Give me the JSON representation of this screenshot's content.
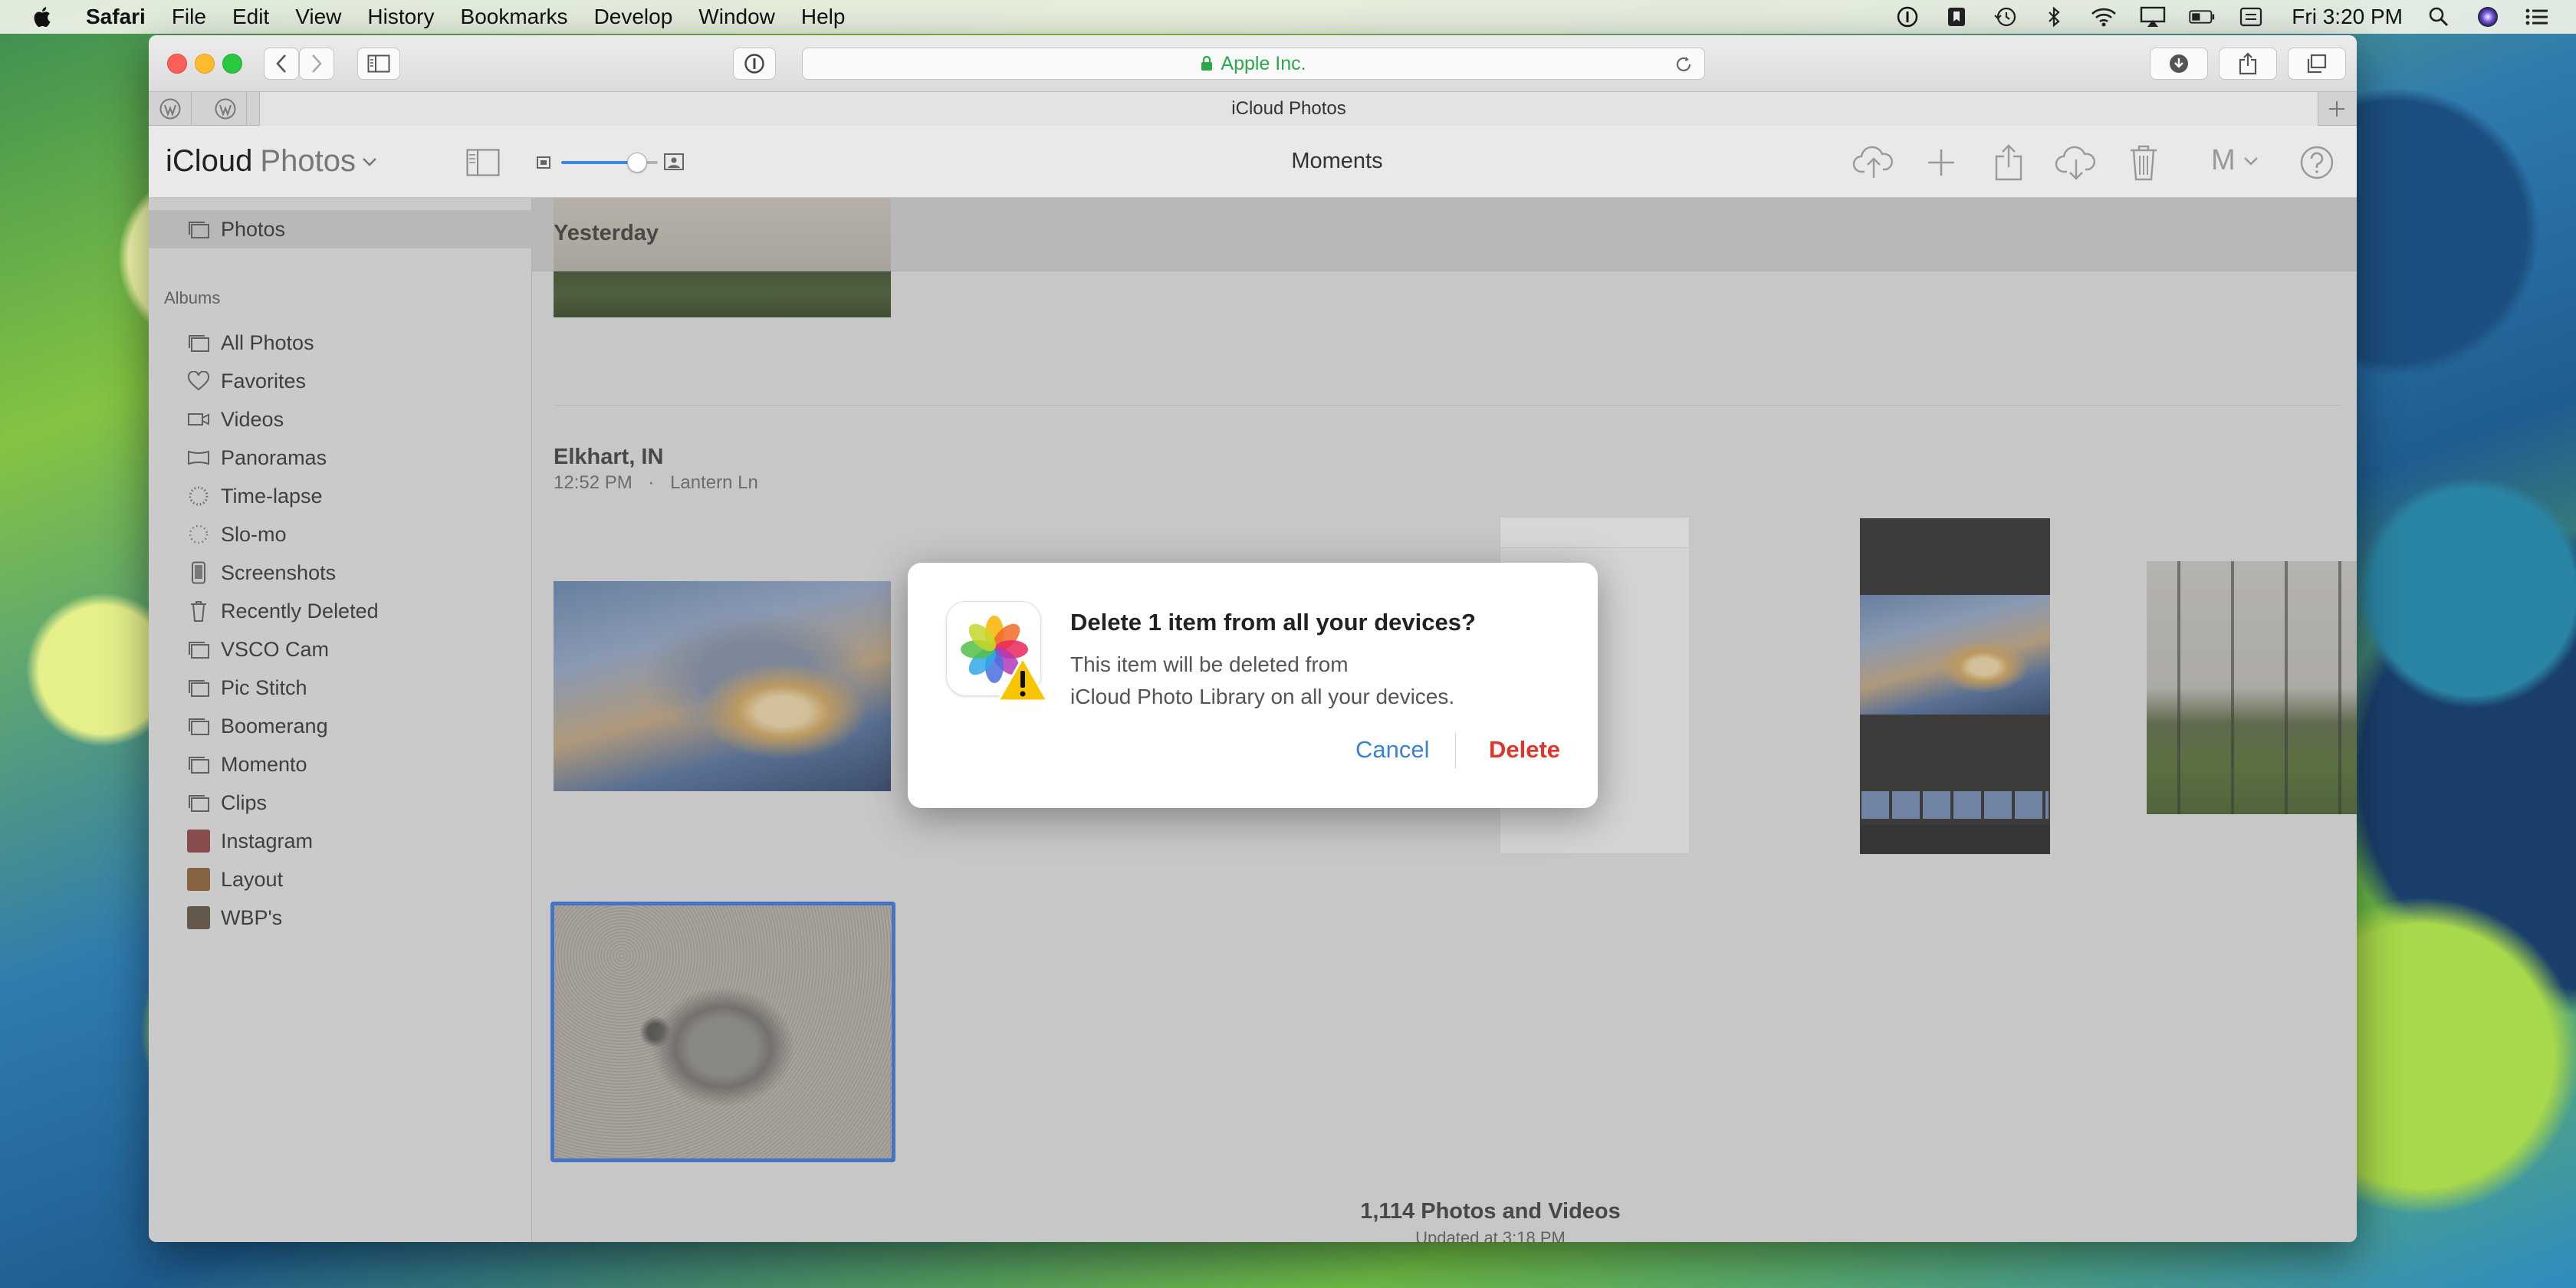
{
  "menubar": {
    "app_name": "Safari",
    "menus": [
      "File",
      "Edit",
      "View",
      "History",
      "Bookmarks",
      "Develop",
      "Window",
      "Help"
    ],
    "clock": "Fri 3:20 PM",
    "status_icons": [
      "1password-icon",
      "bookmark-icon",
      "time-machine-icon",
      "bluetooth-icon",
      "wifi-icon",
      "airplay-icon",
      "battery-icon",
      "keyboard-icon",
      "spotlight-icon",
      "siri-icon",
      "notification-center-icon"
    ]
  },
  "browser": {
    "address": "Apple Inc.",
    "tab_title": "iCloud Photos"
  },
  "app": {
    "brand": "iCloud",
    "brand_app": "Photos",
    "page_title": "Moments",
    "user_initial": "M"
  },
  "sidebar": {
    "top_item": "Photos",
    "albums_heading": "Albums",
    "items": [
      {
        "label": "All Photos",
        "icon": "album-icon"
      },
      {
        "label": "Favorites",
        "icon": "heart-icon"
      },
      {
        "label": "Videos",
        "icon": "video-icon"
      },
      {
        "label": "Panoramas",
        "icon": "panorama-icon"
      },
      {
        "label": "Time-lapse",
        "icon": "timelapse-icon"
      },
      {
        "label": "Slo-mo",
        "icon": "slomo-icon"
      },
      {
        "label": "Screenshots",
        "icon": "screenshot-icon"
      },
      {
        "label": "Recently Deleted",
        "icon": "trash-icon"
      },
      {
        "label": "VSCO Cam",
        "icon": "album-icon"
      },
      {
        "label": "Pic Stitch",
        "icon": "album-icon"
      },
      {
        "label": "Boomerang",
        "icon": "album-icon"
      },
      {
        "label": "Momento",
        "icon": "album-icon"
      },
      {
        "label": "Clips",
        "icon": "album-icon"
      },
      {
        "label": "Instagram",
        "icon": "album-thumb-icon"
      },
      {
        "label": "Layout",
        "icon": "album-thumb-icon"
      },
      {
        "label": "WBP's",
        "icon": "album-thumb-icon"
      }
    ]
  },
  "content": {
    "section_yesterday": "Yesterday",
    "moment_location": "Elkhart, IN",
    "moment_time": "12:52 PM",
    "moment_separator": "·",
    "moment_street": "Lantern Ln",
    "count": "1,114 Photos and Videos",
    "updated": "Updated at 3:18 PM"
  },
  "dialog": {
    "title": "Delete 1 item from all your devices?",
    "message_line1": "This item will be deleted from",
    "message_line2": "iCloud Photo Library on all your devices.",
    "cancel_label": "Cancel",
    "delete_label": "Delete"
  },
  "colors": {
    "accent": "#3b82d6",
    "destructive": "#e0352b",
    "secure": "#2aa84a",
    "selection_border": "#2f6fe0"
  }
}
